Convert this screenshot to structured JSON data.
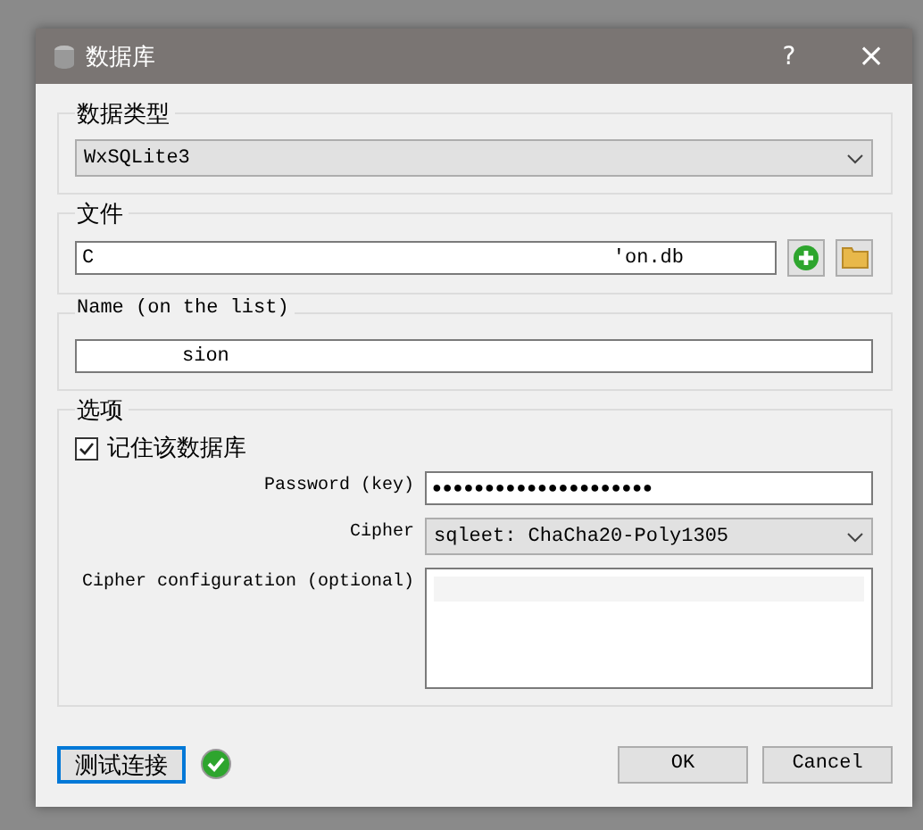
{
  "window": {
    "title": "数据库",
    "help": "?",
    "close": "×"
  },
  "database_type": {
    "title": "数据类型",
    "value": "WxSQLite3"
  },
  "file": {
    "title": "文件",
    "value_start": "C",
    "value_end": "'on.db"
  },
  "name": {
    "title": "Name (on the list)",
    "value_end": "sion"
  },
  "options": {
    "title": "选项",
    "remember": {
      "label": "记住该数据库",
      "checked": true
    },
    "password": {
      "label": "Password (key)",
      "value": "●●●●●●●●●●●●●●●●●●●●●"
    },
    "cipher": {
      "label": "Cipher",
      "value": "sqleet: ChaCha20-Poly1305"
    },
    "cipher_config": {
      "label": "Cipher configuration (optional)"
    }
  },
  "test_button": {
    "label": "测试连接",
    "ok": true
  },
  "buttons": [
    "OK",
    "Cancel"
  ]
}
